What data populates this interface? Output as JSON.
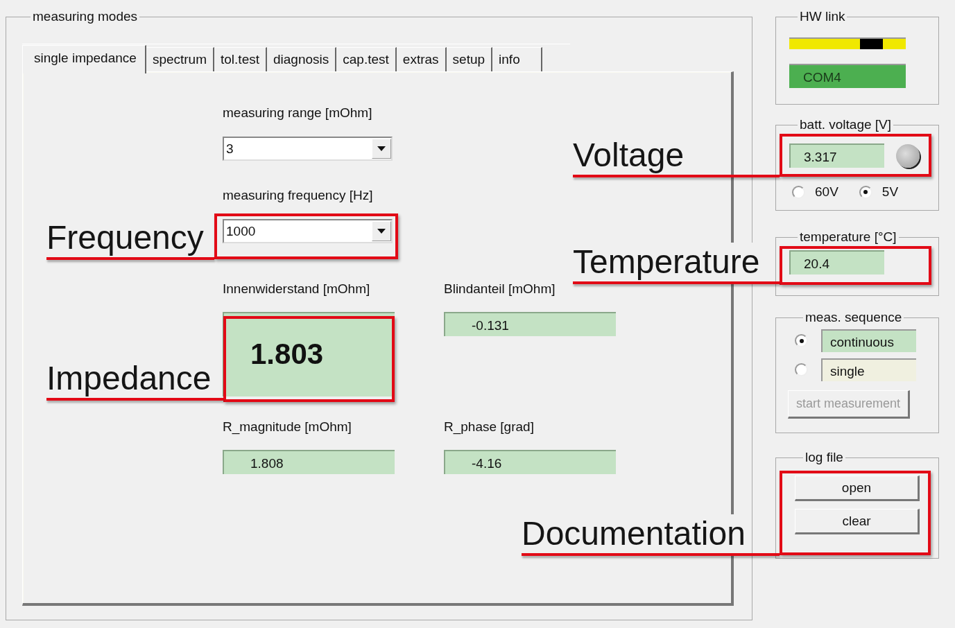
{
  "measuring_modes": {
    "title": "measuring modes",
    "tabs": [
      {
        "label": "single impedance",
        "selected": true
      },
      {
        "label": "spectrum",
        "selected": false
      },
      {
        "label": "tol.test",
        "selected": false
      },
      {
        "label": "diagnosis",
        "selected": false
      },
      {
        "label": "cap.test",
        "selected": false
      },
      {
        "label": "extras",
        "selected": false
      },
      {
        "label": "setup",
        "selected": false
      },
      {
        "label": "info",
        "selected": false
      }
    ],
    "selects": [
      {
        "label": "measuring range [mOhm]",
        "value": "3"
      },
      {
        "label": "measuring frequency [Hz]",
        "value": "1000"
      }
    ],
    "readouts": [
      {
        "label": "Innenwiderstand [mOhm]",
        "value": "1.803",
        "kind": "large"
      },
      {
        "label": "Blindanteil [mOhm]",
        "value": "-0.131",
        "kind": "small"
      },
      {
        "label": "R_magnitude [mOhm]",
        "value": "1.808",
        "kind": "small"
      },
      {
        "label": "R_phase [grad]",
        "value": "-4.16",
        "kind": "small"
      }
    ]
  },
  "hw_link": {
    "title": "HW link",
    "port": "COM4"
  },
  "batt_voltage": {
    "title": "batt. voltage [V]",
    "value": "3.317",
    "ranges": [
      {
        "label": "60V",
        "selected": false
      },
      {
        "label": "5V",
        "selected": true
      }
    ]
  },
  "temperature": {
    "title": "temperature [°C]",
    "value": "20.4"
  },
  "meas_sequence": {
    "title": "meas. sequence",
    "options": [
      {
        "label": "continuous",
        "selected": true
      },
      {
        "label": "single",
        "selected": false
      }
    ],
    "start_button": {
      "label": "start measurement",
      "disabled": true
    }
  },
  "log_file": {
    "title": "log file",
    "buttons": [
      "open",
      "clear"
    ]
  },
  "annotations": [
    {
      "label": "Voltage"
    },
    {
      "label": "Frequency"
    },
    {
      "label": "Temperature"
    },
    {
      "label": "Impedance"
    },
    {
      "label": "Documentation"
    }
  ]
}
